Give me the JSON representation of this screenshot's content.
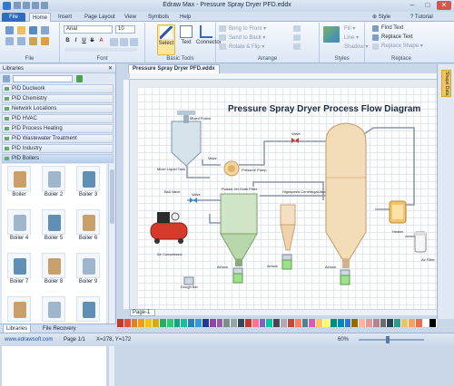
{
  "window": {
    "title": "Edraw Max - Pressure Spray Dryer PFD.eddx",
    "min": "–",
    "max": "□",
    "close": "✕"
  },
  "tabs": {
    "file": "File",
    "items": [
      "Home",
      "Insert",
      "Page Layout",
      "View",
      "Symbols",
      "Help"
    ],
    "style": "Style",
    "tutorial": "Tutorial"
  },
  "ribbon": {
    "groups": {
      "file": "File",
      "font": "Font",
      "basic_tools": "Basic Tools",
      "arrange": "Arrange",
      "styles": "Styles",
      "replace": "Replace"
    },
    "font_name": "Arial",
    "font_size": "10",
    "format": [
      "B",
      "I",
      "U",
      "S",
      "A"
    ],
    "select": "Select",
    "text": "Text",
    "connector": "Connector",
    "arrange": [
      "Bring to Front ▾",
      "Send to Back ▾",
      "Rotate & Flip ▾"
    ],
    "arrange2": [
      "Align ▾",
      "Distribute ▾",
      "Group ▾"
    ],
    "styles_items": [
      "Fill ▾",
      "Line ▾",
      "Shadow ▾"
    ],
    "replace_items": [
      "Find Text",
      "Replace Text",
      "Replace Shape ▾"
    ]
  },
  "libraries": {
    "title": "Libraries",
    "close": "✕",
    "categories": [
      "PID Ductwork",
      "PID Chemistry",
      "Network Locations",
      "PID HVAC",
      "PID Process Heating",
      "PID Wastewater Treatment",
      "PID Industry",
      "PID Boilers"
    ],
    "shapes": [
      "Boiler",
      "Boiler 2",
      "Boiler 3",
      "Boiler 4",
      "Boiler 5",
      "Boiler 6",
      "Boiler 7",
      "Boiler 8",
      "Boiler 9",
      "",
      "",
      ""
    ],
    "bottom_tabs": [
      "Libraries",
      "File Recovery"
    ]
  },
  "document": {
    "tab": "Pressure Spray Dryer PFD.eddx",
    "page_tab": "Page-1",
    "side_panel": "Shape Data"
  },
  "diagram": {
    "title": "Pressure Spray Dryer Process Flow Diagram",
    "labels": {
      "mixer_tank": "Mixed Potion",
      "mixer": "Mixer Liquid Tank",
      "valve1": "Valve",
      "pump": "Pressure Pump",
      "valve2": "Valve",
      "ball_valve": "Ball Valve",
      "valve3": "Valve",
      "filter": "Pulsed Jet Cloth Filter",
      "cyclone": "Highspeed Centrifugal Atomizer",
      "compressor": "Air Compressor",
      "heater": "Heater",
      "air_filter": "Air Filter",
      "airlock1": "Airlock",
      "airlock2": "Airlock",
      "airlock3": "Airlock",
      "discharge": "Dough Bin"
    }
  },
  "palette": [
    "#c0392b",
    "#e74c3c",
    "#e67e22",
    "#f39c12",
    "#f1c40f",
    "#d4ac0d",
    "#27ae60",
    "#2ecc71",
    "#16a085",
    "#1abc9c",
    "#2980b9",
    "#3498db",
    "#1f3a93",
    "#8e44ad",
    "#9b59b6",
    "#7f8c8d",
    "#95a5a6",
    "#34495e",
    "#c0392b",
    "#ff6f91",
    "#845ec2",
    "#00c9a7",
    "#4b4453",
    "#b0a8b9",
    "#c34a36",
    "#ff8066",
    "#4e8397",
    "#d65db1",
    "#ffc75f",
    "#f9f871",
    "#008f7a",
    "#0089ba",
    "#2c73d2",
    "#926c00",
    "#ffb4a2",
    "#e5989b",
    "#b5838d",
    "#6d6875",
    "#264653",
    "#2a9d8f",
    "#e9c46a",
    "#f4a261",
    "#e76f51",
    "#ffffff",
    "#000000"
  ],
  "status": {
    "website": "www.edrawsoft.com",
    "page": "Page 1/1",
    "coords": "X=278, Y=172",
    "zoom": "60%"
  }
}
